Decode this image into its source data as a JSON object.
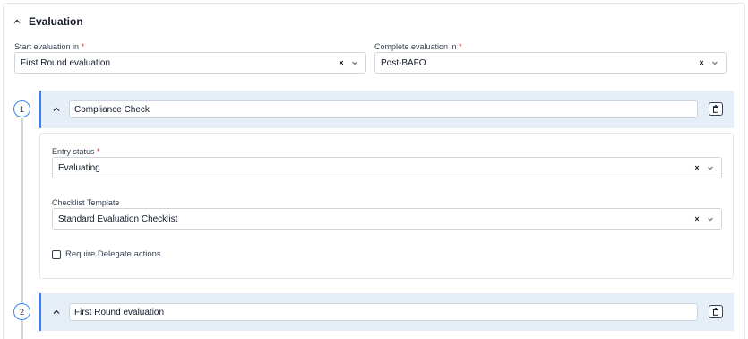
{
  "section": {
    "title": "Evaluation"
  },
  "start_field": {
    "label": "Start evaluation in",
    "required_mark": "*",
    "value": "First Round evaluation",
    "clear": "×"
  },
  "complete_field": {
    "label": "Complete evaluation in",
    "required_mark": "*",
    "value": "Post-BAFO",
    "clear": "×"
  },
  "steps": [
    {
      "number": "1",
      "title": "Compliance Check",
      "entry_status": {
        "label": "Entry status",
        "required_mark": "*",
        "value": "Evaluating",
        "clear": "×"
      },
      "checklist": {
        "label": "Checklist Template",
        "value": "Standard Evaluation Checklist",
        "clear": "×"
      },
      "delegate": {
        "label": "Require Delegate actions",
        "checked": false
      }
    },
    {
      "number": "2",
      "title": "First Round evaluation"
    }
  ],
  "colors": {
    "accent": "#3b82f6",
    "card_header_bg": "#e6eef8",
    "required": "#dc2626"
  },
  "icons": {
    "collapse": "chevron-up-icon",
    "dropdown": "chevron-down-icon",
    "clear": "clear-icon",
    "delete": "trash-icon"
  }
}
